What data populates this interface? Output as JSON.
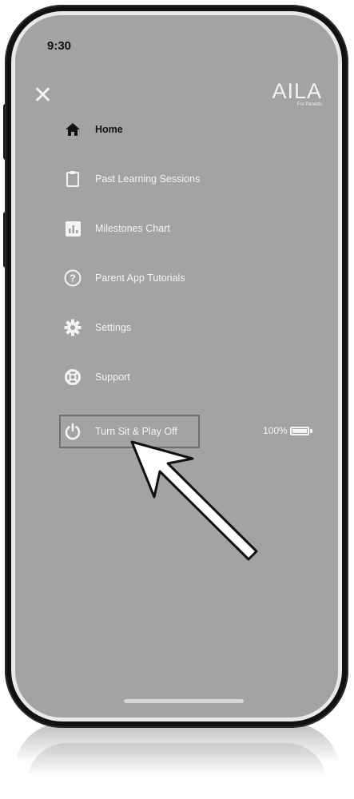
{
  "status_bar": {
    "time": "9:30"
  },
  "header": {
    "close_icon": "close-icon",
    "logo_text": "AILA",
    "logo_tagline": "For Parents"
  },
  "menu": {
    "items": [
      {
        "label": "Home",
        "icon": "home-icon"
      },
      {
        "label": "Past Learning Sessions",
        "icon": "clipboard-icon"
      },
      {
        "label": "Milestones Chart",
        "icon": "chart-icon"
      },
      {
        "label": "Parent App Tutorials",
        "icon": "help-icon"
      },
      {
        "label": "Settings",
        "icon": "gear-icon"
      },
      {
        "label": "Support",
        "icon": "lifebuoy-icon"
      },
      {
        "label": "Turn Sit & Play Off",
        "icon": "power-icon"
      }
    ]
  },
  "device": {
    "battery_level": "100%"
  },
  "colors": {
    "screen_background": "#a3a3a3",
    "text_light": "#f4f4f4",
    "text_dark": "#111111"
  }
}
